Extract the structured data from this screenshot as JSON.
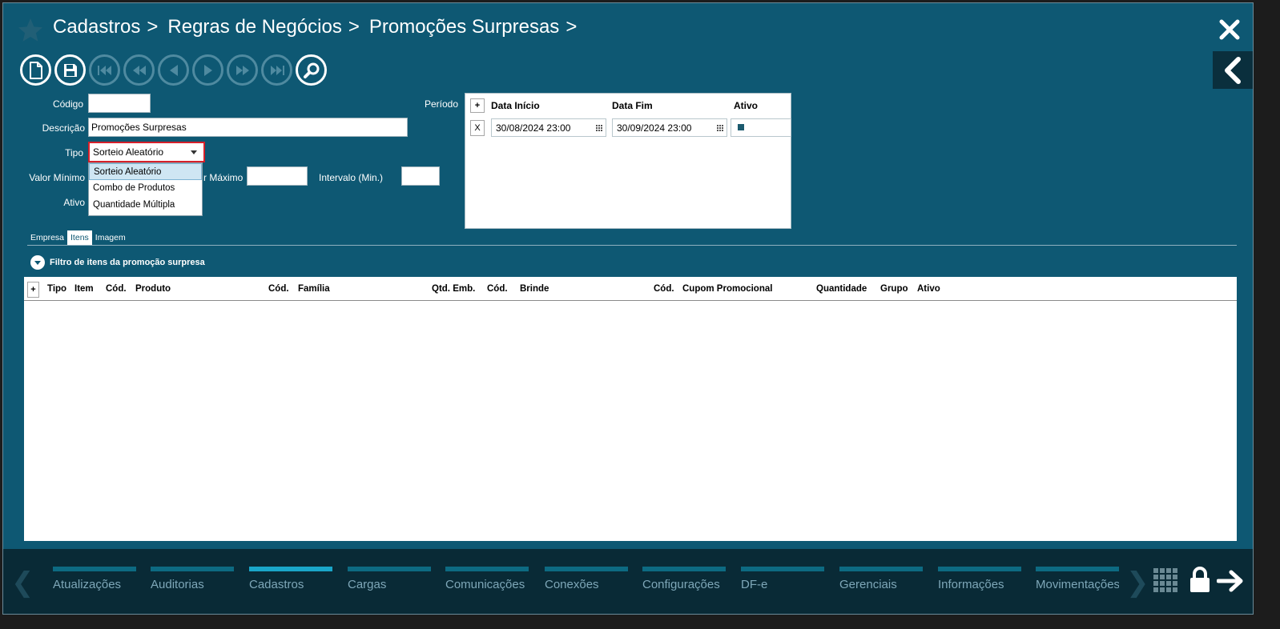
{
  "breadcrumb": [
    "Cadastros",
    "Regras de Negócios",
    "Promoções Surpresas"
  ],
  "breadcrumb_sep": ">",
  "form": {
    "codigo_label": "Código",
    "codigo_value": "",
    "descricao_label": "Descrição",
    "descricao_value": "Promoções Surpresas",
    "tipo_label": "Tipo",
    "tipo_value": "Sorteio Aleatório",
    "tipo_options": [
      "Sorteio Aleatório",
      "Combo de Produtos",
      "Quantidade Múltipla"
    ],
    "valor_minimo_label": "Valor Mínimo",
    "valor_maximo_label": "r Máximo",
    "intervalo_label": "Intervalo (Min.)",
    "ativo_label": "Ativo",
    "periodo_label": "Período"
  },
  "periodo": {
    "add_label": "+",
    "headers": [
      "Data Início",
      "Data Fim",
      "Ativo"
    ],
    "rows": [
      {
        "remove": "X",
        "inicio": "30/08/2024 23:00",
        "fim": "30/09/2024 23:00",
        "ativo": true
      }
    ]
  },
  "tabs": [
    "Empresa",
    "Itens",
    "Imagem"
  ],
  "active_tab": "Itens",
  "filter_label": "Filtro de itens da promoção surpresa",
  "items_grid": {
    "add_label": "+",
    "headers": [
      "Tipo",
      "Item",
      "Cód.",
      "Produto",
      "Cód.",
      "Família",
      "Qtd. Emb.",
      "Cód.",
      "Brinde",
      "Cód.",
      "Cupom Promocional",
      "Quantidade",
      "Grupo",
      "Ativo"
    ]
  },
  "bottom_nav": {
    "items": [
      "Atualizações",
      "Auditorias",
      "Cadastros",
      "Cargas",
      "Comunicações",
      "Conexões",
      "Configurações",
      "DF-e",
      "Gerenciais",
      "Informações",
      "Movimentações"
    ],
    "active": "Cadastros"
  },
  "colors": {
    "background": "#0e5873",
    "bottom": "#092a36",
    "active_nav": "#1aa6c9",
    "nav_bar": "#0d6a82",
    "select_border": "#d6202a"
  }
}
